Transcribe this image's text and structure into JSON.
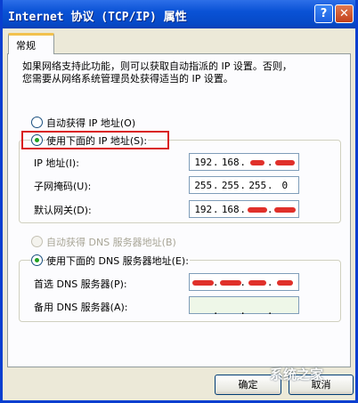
{
  "window": {
    "title": "Internet 协议 (TCP/IP) 属性",
    "help_label": "?",
    "close_label": "✕"
  },
  "tabs": [
    {
      "label": "常规"
    }
  ],
  "description": "如果网络支持此功能，则可以获取自动指派的 IP 设置。否则，\n您需要从网络系统管理员处获得适当的 IP 设置。",
  "ip_mode": {
    "auto": {
      "label": "自动获得 IP 地址(O)",
      "checked": false
    },
    "manual": {
      "label": "使用下面的 IP 地址(S):",
      "checked": true
    }
  },
  "ip_fields": [
    {
      "label": "IP 地址(I):",
      "segments": [
        "192",
        "168",
        "",
        ""
      ],
      "redacted": true
    },
    {
      "label": "子网掩码(U):",
      "segments": [
        "255",
        "255",
        "255",
        "0"
      ],
      "redacted": false
    },
    {
      "label": "默认网关(D):",
      "segments": [
        "192",
        "168",
        "",
        ""
      ],
      "redacted": true
    }
  ],
  "dns_mode": {
    "auto": {
      "label": "自动获得 DNS 服务器地址(B)",
      "checked": false,
      "enabled": false
    },
    "manual": {
      "label": "使用下面的 DNS 服务器地址(E):",
      "checked": true
    }
  },
  "dns_fields": [
    {
      "label": "首选 DNS 服务器(P):",
      "segments": [
        "",
        "",
        "",
        ""
      ],
      "redacted": true
    },
    {
      "label": "备用 DNS 服务器(A):",
      "segments": [
        "",
        "",
        "",
        ""
      ],
      "redacted": false
    }
  ],
  "buttons": {
    "ok": "确定",
    "cancel": "取消"
  },
  "watermark": "系统之家"
}
